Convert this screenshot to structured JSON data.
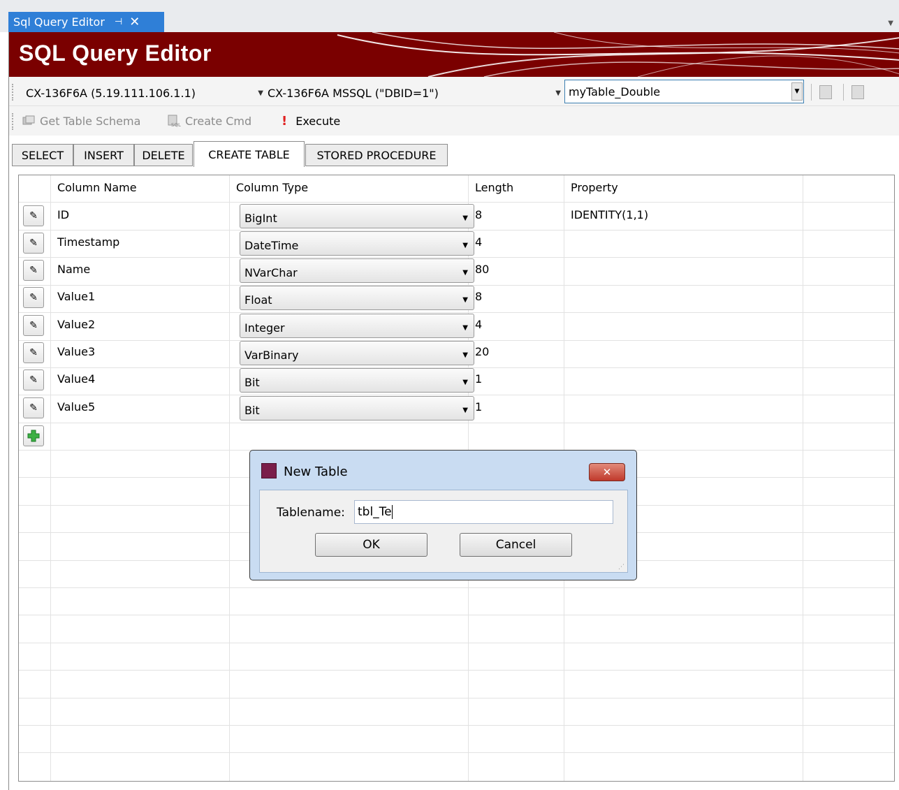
{
  "doc_tab": {
    "title": "Sql Query Editor",
    "pin": "⊣",
    "close": "✕"
  },
  "banner": {
    "title": "SQL Query Editor"
  },
  "connection": {
    "target": "CX-136F6A (5.19.111.106.1.1)",
    "database": "CX-136F6A MSSQL (\"DBID=1\")",
    "table": "myTable_Double"
  },
  "commands": {
    "get_schema": "Get Table Schema",
    "create_cmd": "Create Cmd",
    "execute": "Execute"
  },
  "tabs": [
    "SELECT",
    "INSERT",
    "DELETE",
    "CREATE TABLE",
    "STORED PROCEDURE"
  ],
  "grid": {
    "headers": [
      "Column Name",
      "Column Type",
      "Length",
      "Property"
    ],
    "rows": [
      {
        "name": "ID",
        "type": "BigInt",
        "length": "8",
        "property": "IDENTITY(1,1)"
      },
      {
        "name": "Timestamp",
        "type": "DateTime",
        "length": "4",
        "property": ""
      },
      {
        "name": "Name",
        "type": "NVarChar",
        "length": "80",
        "property": ""
      },
      {
        "name": "Value1",
        "type": "Float",
        "length": "8",
        "property": ""
      },
      {
        "name": "Value2",
        "type": "Integer",
        "length": "4",
        "property": ""
      },
      {
        "name": "Value3",
        "type": "VarBinary",
        "length": "20",
        "property": ""
      },
      {
        "name": "Value4",
        "type": "Bit",
        "length": "1",
        "property": ""
      },
      {
        "name": "Value5",
        "type": "Bit",
        "length": "1",
        "property": ""
      }
    ]
  },
  "dialog": {
    "title": "New Table",
    "label": "Tablename:",
    "value": "tbl_Te",
    "ok": "OK",
    "cancel": "Cancel"
  }
}
